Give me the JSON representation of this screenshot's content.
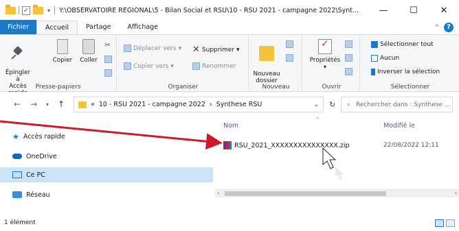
{
  "titlebar": {
    "path": "Y:\\OBSERVATOIRE REGIONAL\\5 - Bilan Social et RSU\\10 - RSU 2021 - campagne 2022\\Synt...",
    "minimize": "—",
    "maximize": "☐",
    "close": "✕"
  },
  "tabs": {
    "file": "Fichier",
    "home": "Accueil",
    "share": "Partage",
    "view": "Affichage",
    "collapse": "^",
    "help": "?"
  },
  "ribbon": {
    "clipboard": {
      "label": "Presse-papiers",
      "pin": "Épingler à\nAccès rapide",
      "copy": "Copier",
      "paste": "Coller"
    },
    "organize": {
      "label": "Organiser",
      "move_to": "Déplacer vers",
      "copy_to": "Copier vers",
      "delete": "Supprimer",
      "rename": "Renommer"
    },
    "new": {
      "label": "Nouveau",
      "new_folder": "Nouveau\ndossier"
    },
    "open": {
      "label": "Ouvrir",
      "properties": "Propriétés"
    },
    "select": {
      "label": "Sélectionner",
      "select_all": "Sélectionner tout",
      "select_none": "Aucun",
      "invert": "Inverser la sélection"
    }
  },
  "address": {
    "breadcrumb_prefix": "«",
    "crumb1": "10 - RSU 2021 - campagne 2022",
    "sep": "›",
    "crumb2": "Synthese RSU",
    "search_placeholder": "Rechercher dans : Synthese ..."
  },
  "navpane": {
    "items": [
      "Accès rapide",
      "OneDrive",
      "Ce PC",
      "Réseau"
    ]
  },
  "filepane": {
    "col_name": "Nom",
    "col_modified": "Modifié le",
    "files": [
      {
        "name": "RSU_2021_XXXXXXXXXXXXXXX.zip",
        "modified": "22/08/2022 12:11"
      }
    ]
  },
  "status": {
    "count": "1 élément"
  },
  "colors": {
    "accent": "#1979ca",
    "selection": "#cce4f7",
    "annotation_arrow": "#cc1a2a"
  }
}
